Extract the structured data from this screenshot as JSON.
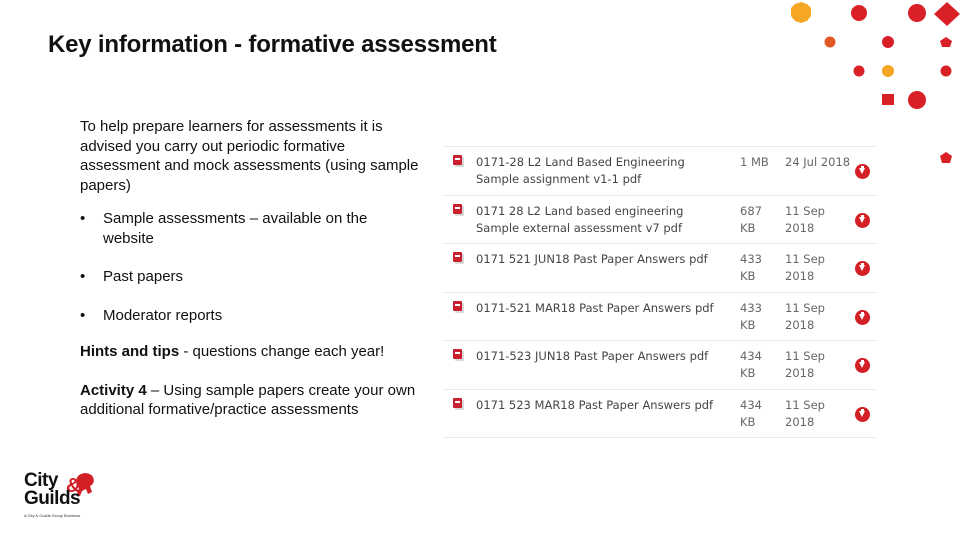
{
  "page": {
    "title": "Key information -  formative assessment"
  },
  "left_content": {
    "intro": "To help prepare learners for assessments it is advised you carry out periodic formative assessment and mock assessments (using sample papers)",
    "bullet_char": "•",
    "bullets": [
      "Sample assessments – available on the website",
      "Past papers",
      "Moderator reports"
    ],
    "hints": {
      "bold": "Hints and tips",
      "text": " - questions change each year!"
    },
    "activity": {
      "bold": "Activity 4",
      "text": " – Using sample papers create your own additional formative/practice assessments"
    }
  },
  "files": [
    {
      "icon": "pdf-icon",
      "name": "0171-28 L2 Land Based Engineering Sample assignment v1-1 pdf",
      "size": "1 MB",
      "date": "24 Jul 2018",
      "action": "download-icon"
    },
    {
      "icon": "pdf-icon",
      "name": "0171 28 L2 Land based engineering Sample external assessment v7 pdf",
      "size": "687 KB",
      "date": "11 Sep 2018",
      "action": "download-icon"
    },
    {
      "icon": "pdf-icon",
      "name": "0171 521 JUN18 Past Paper Answers pdf",
      "size": "433 KB",
      "date": "11 Sep 2018",
      "action": "download-icon"
    },
    {
      "icon": "pdf-icon",
      "name": "0171-521 MAR18 Past Paper Answers pdf",
      "size": "433 KB",
      "date": "11 Sep 2018",
      "action": "download-icon"
    },
    {
      "icon": "pdf-icon",
      "name": "0171-523 JUN18 Past Paper Answers pdf",
      "size": "434 KB",
      "date": "11 Sep 2018",
      "action": "download-icon"
    },
    {
      "icon": "pdf-icon",
      "name": "0171 523 MAR18 Past Paper Answers pdf",
      "size": "434 KB",
      "date": "11 Sep 2018",
      "action": "download-icon"
    }
  ],
  "logo": {
    "line1": "City",
    "ampersand": "&",
    "line2": "Guilds",
    "tagline": "A City & Guilds Group Business"
  },
  "colors": {
    "brand_red": "#d31f26",
    "accent_orange": "#f5a623",
    "accent_dark_orange": "#e25822"
  }
}
